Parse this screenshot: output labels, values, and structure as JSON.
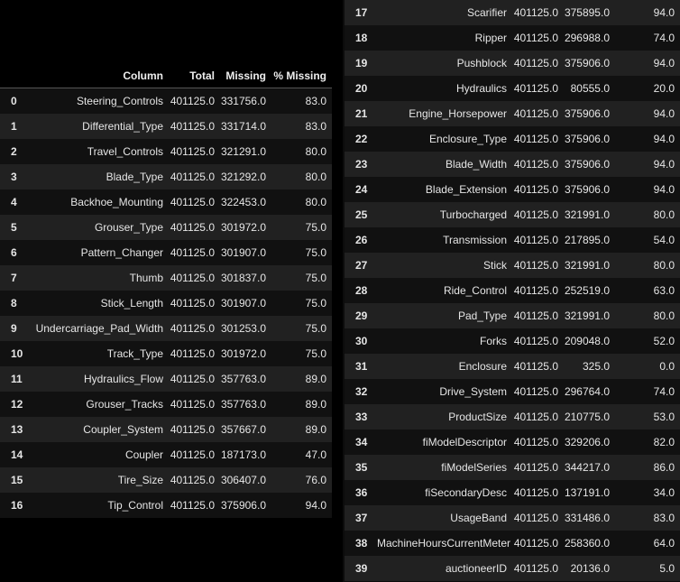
{
  "headers": [
    "",
    "Column",
    "Total",
    "Missing",
    "% Missing"
  ],
  "left_rows": [
    [
      "0",
      "Steering_Controls",
      "401125.0",
      "331756.0",
      "83.0"
    ],
    [
      "1",
      "Differential_Type",
      "401125.0",
      "331714.0",
      "83.0"
    ],
    [
      "2",
      "Travel_Controls",
      "401125.0",
      "321291.0",
      "80.0"
    ],
    [
      "3",
      "Blade_Type",
      "401125.0",
      "321292.0",
      "80.0"
    ],
    [
      "4",
      "Backhoe_Mounting",
      "401125.0",
      "322453.0",
      "80.0"
    ],
    [
      "5",
      "Grouser_Type",
      "401125.0",
      "301972.0",
      "75.0"
    ],
    [
      "6",
      "Pattern_Changer",
      "401125.0",
      "301907.0",
      "75.0"
    ],
    [
      "7",
      "Thumb",
      "401125.0",
      "301837.0",
      "75.0"
    ],
    [
      "8",
      "Stick_Length",
      "401125.0",
      "301907.0",
      "75.0"
    ],
    [
      "9",
      "Undercarriage_Pad_Width",
      "401125.0",
      "301253.0",
      "75.0"
    ],
    [
      "10",
      "Track_Type",
      "401125.0",
      "301972.0",
      "75.0"
    ],
    [
      "11",
      "Hydraulics_Flow",
      "401125.0",
      "357763.0",
      "89.0"
    ],
    [
      "12",
      "Grouser_Tracks",
      "401125.0",
      "357763.0",
      "89.0"
    ],
    [
      "13",
      "Coupler_System",
      "401125.0",
      "357667.0",
      "89.0"
    ],
    [
      "14",
      "Coupler",
      "401125.0",
      "187173.0",
      "47.0"
    ],
    [
      "15",
      "Tire_Size",
      "401125.0",
      "306407.0",
      "76.0"
    ],
    [
      "16",
      "Tip_Control",
      "401125.0",
      "375906.0",
      "94.0"
    ]
  ],
  "right_rows": [
    [
      "17",
      "Scarifier",
      "401125.0",
      "375895.0",
      "94.0"
    ],
    [
      "18",
      "Ripper",
      "401125.0",
      "296988.0",
      "74.0"
    ],
    [
      "19",
      "Pushblock",
      "401125.0",
      "375906.0",
      "94.0"
    ],
    [
      "20",
      "Hydraulics",
      "401125.0",
      "80555.0",
      "20.0"
    ],
    [
      "21",
      "Engine_Horsepower",
      "401125.0",
      "375906.0",
      "94.0"
    ],
    [
      "22",
      "Enclosure_Type",
      "401125.0",
      "375906.0",
      "94.0"
    ],
    [
      "23",
      "Blade_Width",
      "401125.0",
      "375906.0",
      "94.0"
    ],
    [
      "24",
      "Blade_Extension",
      "401125.0",
      "375906.0",
      "94.0"
    ],
    [
      "25",
      "Turbocharged",
      "401125.0",
      "321991.0",
      "80.0"
    ],
    [
      "26",
      "Transmission",
      "401125.0",
      "217895.0",
      "54.0"
    ],
    [
      "27",
      "Stick",
      "401125.0",
      "321991.0",
      "80.0"
    ],
    [
      "28",
      "Ride_Control",
      "401125.0",
      "252519.0",
      "63.0"
    ],
    [
      "29",
      "Pad_Type",
      "401125.0",
      "321991.0",
      "80.0"
    ],
    [
      "30",
      "Forks",
      "401125.0",
      "209048.0",
      "52.0"
    ],
    [
      "31",
      "Enclosure",
      "401125.0",
      "325.0",
      "0.0"
    ],
    [
      "32",
      "Drive_System",
      "401125.0",
      "296764.0",
      "74.0"
    ],
    [
      "33",
      "ProductSize",
      "401125.0",
      "210775.0",
      "53.0"
    ],
    [
      "34",
      "fiModelDescriptor",
      "401125.0",
      "329206.0",
      "82.0"
    ],
    [
      "35",
      "fiModelSeries",
      "401125.0",
      "344217.0",
      "86.0"
    ],
    [
      "36",
      "fiSecondaryDesc",
      "401125.0",
      "137191.0",
      "34.0"
    ],
    [
      "37",
      "UsageBand",
      "401125.0",
      "331486.0",
      "83.0"
    ],
    [
      "38",
      "MachineHoursCurrentMeter",
      "401125.0",
      "258360.0",
      "64.0"
    ],
    [
      "39",
      "auctioneerID",
      "401125.0",
      "20136.0",
      "5.0"
    ]
  ]
}
